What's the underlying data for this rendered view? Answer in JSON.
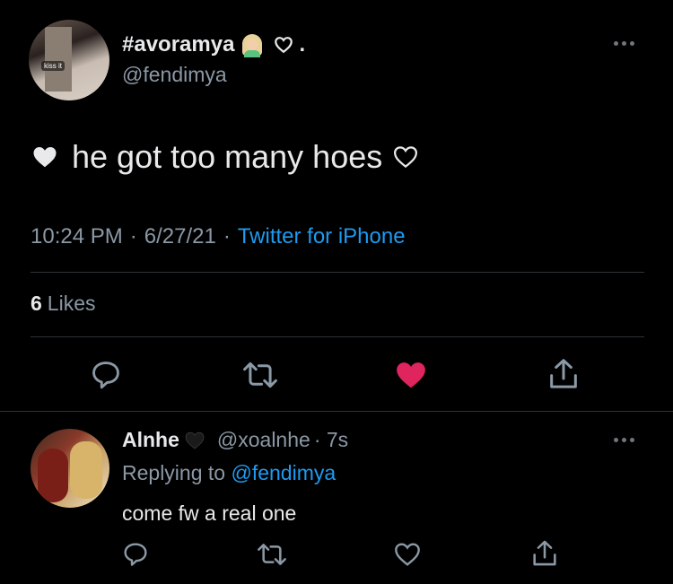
{
  "tweet": {
    "display_name": "#avoramya",
    "name_suffix": ".",
    "handle": "@fendimya",
    "avatar_sticker": "kiss it",
    "text": "he got too many hoes",
    "time": "10:24 PM",
    "date": "6/27/21",
    "separator": "·",
    "source": "Twitter for iPhone",
    "likes_count": "6",
    "likes_label": "Likes",
    "liked": true
  },
  "reply": {
    "display_name": "Alnhe",
    "handle": "@xoalnhe",
    "age": "· 7s",
    "replying_label": "Replying to",
    "replying_to": "@fendimya",
    "text": "come fw a real one"
  },
  "colors": {
    "background": "#000000",
    "text_primary": "#e7e9ea",
    "text_secondary": "#8b98a5",
    "link": "#1d9bf0",
    "like_red": "#f91880",
    "divider": "#2f3336"
  },
  "icons": {
    "actions": [
      "reply-icon",
      "retweet-icon",
      "like-icon",
      "share-icon"
    ],
    "more": "more-options-icon"
  }
}
